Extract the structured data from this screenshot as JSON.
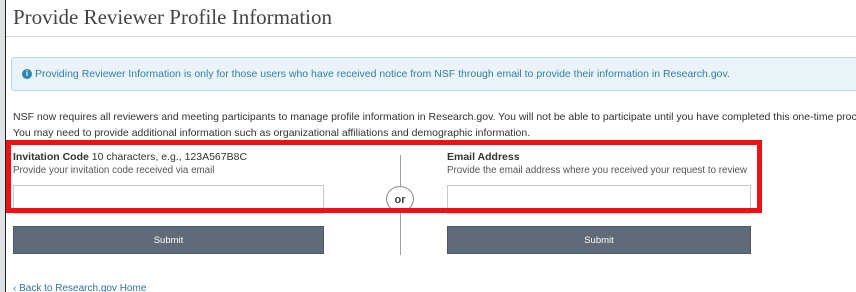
{
  "header": {
    "title": "Provide Reviewer Profile Information"
  },
  "alert": {
    "icon": "info-circle-icon",
    "text": "Providing Reviewer Information is only for those users who have received notice from NSF through email to provide their information in Research.gov."
  },
  "intro": {
    "line1": "NSF now requires all reviewers and meeting participants to manage profile information in Research.gov. You will not be able to participate until you have completed this one-time process.",
    "line2": "You may need to provide additional information such as organizational affiliations and demographic information."
  },
  "invitation": {
    "label": "Invitation Code",
    "hint": "10 characters, e.g., 123A567B8C",
    "help": "Provide your invitation code received via email",
    "value": "",
    "submit_label": "Submit"
  },
  "divider": {
    "label": "or"
  },
  "email": {
    "label": "Email Address",
    "help": "Provide the email address where you received your request to review",
    "value": "",
    "submit_label": "Submit"
  },
  "footer": {
    "back_link": "‹ Back to Research.gov Home"
  },
  "colors": {
    "alert_text": "#2f80ad",
    "button_bg": "#5f6b78",
    "highlight": "#ee1111"
  }
}
